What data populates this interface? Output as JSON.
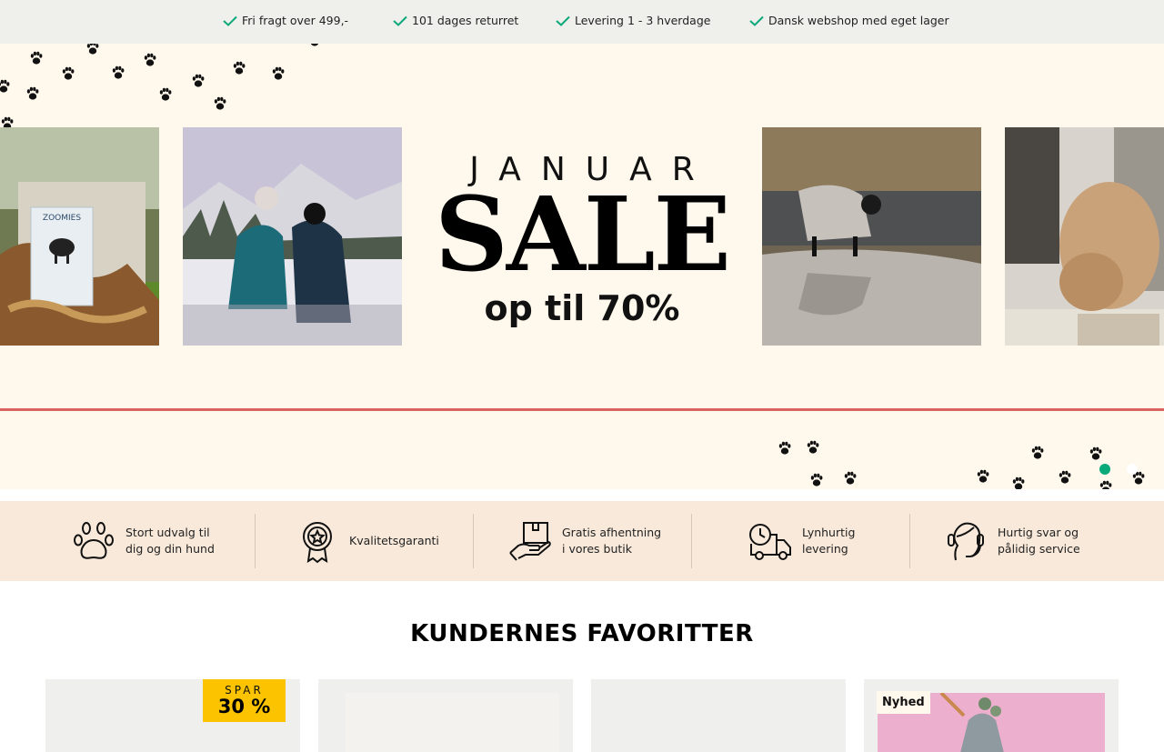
{
  "usp_bar": {
    "items": [
      {
        "label": "Fri fragt over 499,-",
        "icon": "check-icon"
      },
      {
        "label": "101 dages returret",
        "icon": "check-icon"
      },
      {
        "label": "Levering 1 - 3 hverdage",
        "icon": "check-icon"
      },
      {
        "label": "Dansk webshop med eget lager",
        "icon": "check-icon"
      }
    ],
    "check_color": "#0aa97a"
  },
  "hero": {
    "headline_top": "JANUAR",
    "headline_main": "SALE",
    "headline_bottom": "op til 70%",
    "product_brand": "ZOOMIES",
    "background": "#fff8ec",
    "accent_line_color": "#d9645e",
    "slides_total": 2,
    "active_slide": 1,
    "active_dot_color": "#0aa97a"
  },
  "features": {
    "items": [
      {
        "line1": "Stort udvalg til",
        "line2": "dig og din hund",
        "icon": "paw-icon"
      },
      {
        "line1": "Kvalitetsgaranti",
        "line2": "",
        "icon": "quality-badge-icon"
      },
      {
        "line1": "Gratis afhentning",
        "line2": "i vores butik",
        "icon": "package-hand-icon"
      },
      {
        "line1": "Lynhurtig",
        "line2": "levering",
        "icon": "delivery-truck-icon"
      },
      {
        "line1": "Hurtig svar og",
        "line2": "pålidig service",
        "icon": "support-headset-icon"
      }
    ],
    "background": "#f8e9da"
  },
  "favorites": {
    "title": "KUNDERNES FAVORITTER",
    "cards": [
      {
        "badge_type": "discount",
        "badge_label": "SPAR",
        "badge_value": "30 %"
      },
      {
        "badge_type": "",
        "badge_label": "",
        "badge_value": ""
      },
      {
        "badge_type": "",
        "badge_label": "",
        "badge_value": ""
      },
      {
        "badge_type": "new",
        "badge_label": "Nyhed",
        "badge_value": ""
      }
    ],
    "discount_badge_color": "#fcc400"
  }
}
